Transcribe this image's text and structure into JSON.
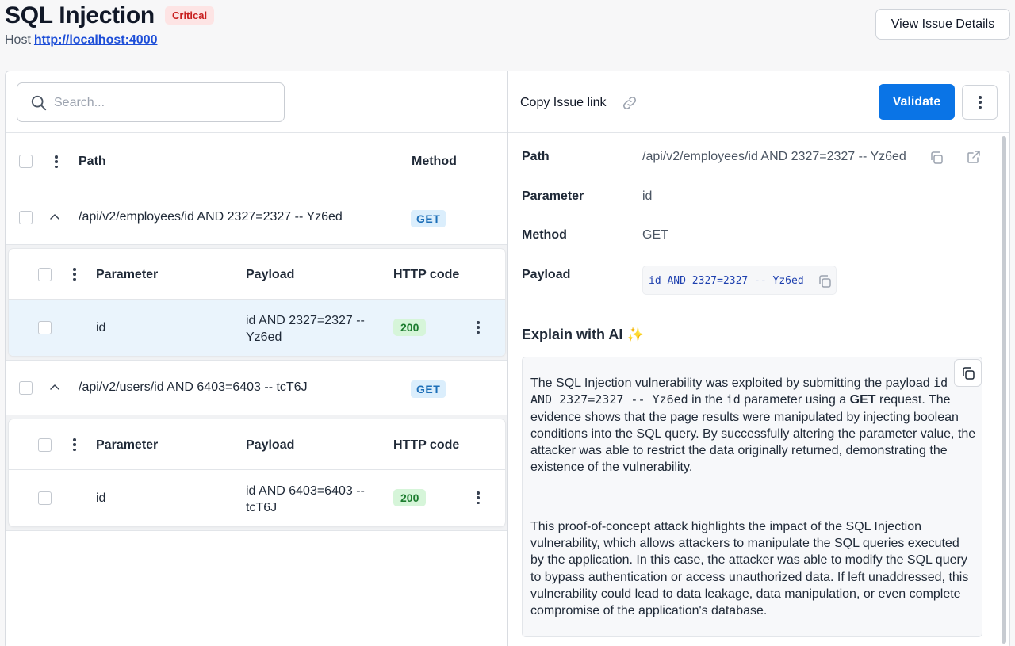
{
  "header": {
    "title": "SQL Injection",
    "severity": "Critical",
    "host_label": "Host",
    "host_url": "http://localhost:4000",
    "view_details_label": "View Issue Details"
  },
  "left": {
    "search_placeholder": "Search...",
    "columns": {
      "path": "Path",
      "method": "Method"
    },
    "sub_columns": {
      "parameter": "Parameter",
      "payload": "Payload",
      "http_code": "HTTP code"
    },
    "groups": [
      {
        "path": "/api/v2/employees/id AND 2327=2327 -- Yz6ed",
        "method": "GET",
        "rows": [
          {
            "parameter": "id",
            "payload_line1": "id AND 2327=2327 --",
            "payload_line2": "Yz6ed",
            "http_code": "200"
          }
        ]
      },
      {
        "path": "/api/v2/users/id AND 6403=6403 -- tcT6J",
        "method": "GET",
        "rows": [
          {
            "parameter": "id",
            "payload_line1": "id AND 6403=6403 --",
            "payload_line2": "tcT6J",
            "http_code": "200"
          }
        ]
      }
    ]
  },
  "right": {
    "copy_link_label": "Copy Issue link",
    "validate_label": "Validate",
    "details": {
      "path_label": "Path",
      "path_value": "/api/v2/employees/id AND 2327=2327 -- Yz6ed",
      "parameter_label": "Parameter",
      "parameter_value": "id",
      "method_label": "Method",
      "method_value": "GET",
      "payload_label": "Payload",
      "payload_value": "id AND 2327=2327 -- Yz6ed"
    },
    "explain": {
      "title": "Explain with AI",
      "sparkle": "✨",
      "p1_a": "The SQL Injection vulnerability was exploited by submitting the payload ",
      "p1_code1": "id AND 2327=2327 -- Yz6ed",
      "p1_b": " in the ",
      "p1_code2": "id",
      "p1_c": " parameter using a ",
      "p1_bold": "GET",
      "p1_d": " request. The evidence shows that the page results were manipulated by injecting boolean conditions into the SQL query. By successfully altering the parameter value, the attacker was able to restrict the data originally returned, demonstrating the existence of the vulnerability.",
      "p2": "This proof-of-concept attack highlights the impact of the SQL Injection vulnerability, which allows attackers to manipulate the SQL queries executed by the application. In this case, the attacker was able to modify the SQL query to bypass authentication or access unauthorized data. If left unaddressed, this vulnerability could lead to data leakage, data manipulation, or even complete compromise of the application's database."
    }
  },
  "colors": {
    "accent": "#0a74e6",
    "critical_bg": "#fde4e4",
    "critical_text": "#c81e1e",
    "get_bg": "#dbeefc",
    "ok_bg": "#d6f5d9"
  },
  "icons": [
    "search-icon",
    "chevron-up-icon",
    "kebab-icon",
    "link-icon",
    "copy-icon",
    "external-link-icon"
  ]
}
